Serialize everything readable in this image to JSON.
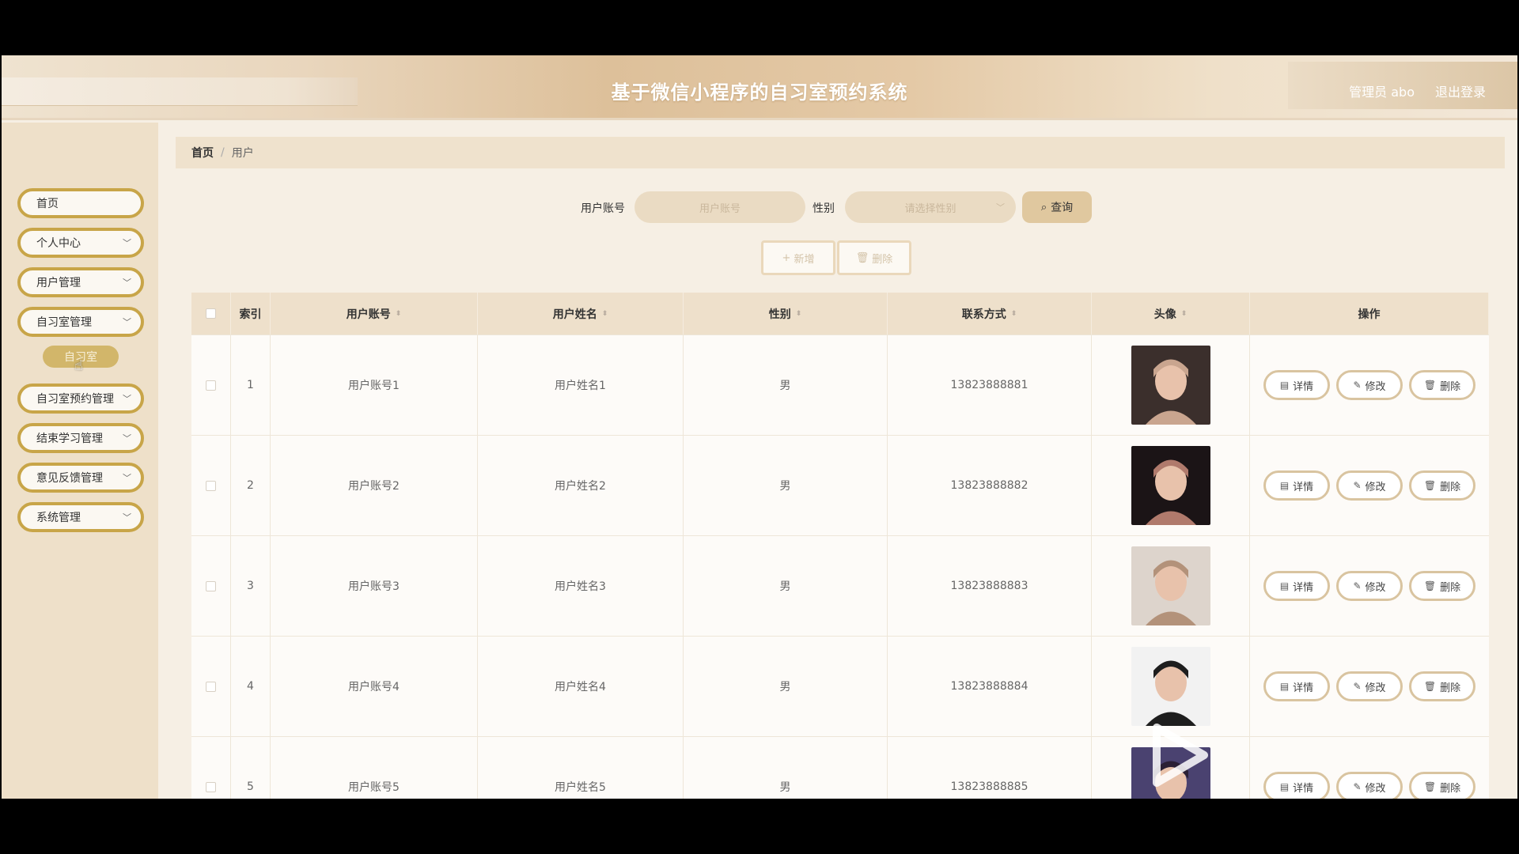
{
  "header": {
    "title": "基于微信小程序的自习室预约系统",
    "admin": "管理员 abo",
    "logout": "退出登录"
  },
  "sidebar": {
    "items": [
      {
        "label": "首页",
        "has_arrow": false
      },
      {
        "label": "个人中心",
        "has_arrow": true
      },
      {
        "label": "用户管理",
        "has_arrow": true
      },
      {
        "label": "自习室管理",
        "has_arrow": true
      },
      {
        "label": "自习室预约管理",
        "has_arrow": true
      },
      {
        "label": "结束学习管理",
        "has_arrow": true
      },
      {
        "label": "意见反馈管理",
        "has_arrow": true
      },
      {
        "label": "系统管理",
        "has_arrow": true
      }
    ],
    "submenu_label": "自习室"
  },
  "breadcrumb": {
    "home": "首页",
    "sep": "/",
    "current": "用户"
  },
  "search": {
    "account_label": "用户账号",
    "account_placeholder": "用户账号",
    "gender_label": "性别",
    "gender_placeholder": "请选择性别",
    "query_button": "查询"
  },
  "toolbar": {
    "add_label": "新增",
    "delete_label": "删除"
  },
  "table": {
    "headers": {
      "index": "索引",
      "account": "用户账号",
      "name": "用户姓名",
      "gender": "性别",
      "phone": "联系方式",
      "avatar": "头像",
      "ops": "操作"
    },
    "rows": [
      {
        "index": "1",
        "account": "用户账号1",
        "name": "用户姓名1",
        "gender": "男",
        "phone": "13823888881"
      },
      {
        "index": "2",
        "account": "用户账号2",
        "name": "用户姓名2",
        "gender": "男",
        "phone": "13823888882"
      },
      {
        "index": "3",
        "account": "用户账号3",
        "name": "用户姓名3",
        "gender": "男",
        "phone": "13823888883"
      },
      {
        "index": "4",
        "account": "用户账号4",
        "name": "用户姓名4",
        "gender": "男",
        "phone": "13823888884"
      },
      {
        "index": "5",
        "account": "用户账号5",
        "name": "用户姓名5",
        "gender": "男",
        "phone": "13823888885"
      }
    ],
    "ops": {
      "detail": "详情",
      "edit": "修改",
      "delete": "删除"
    }
  },
  "icons": {
    "chevron": "chevron-down-icon",
    "search": "search-icon",
    "plus": "plus-icon",
    "trash": "trash-icon",
    "doc": "document-icon",
    "pencil": "pencil-icon",
    "cursor": "hand-cursor-icon",
    "play": "play-icon"
  },
  "colors": {
    "menu_border": "#c8a548",
    "header_accent": "#ddc09a",
    "sidebar_bg": "#eee0c9"
  }
}
